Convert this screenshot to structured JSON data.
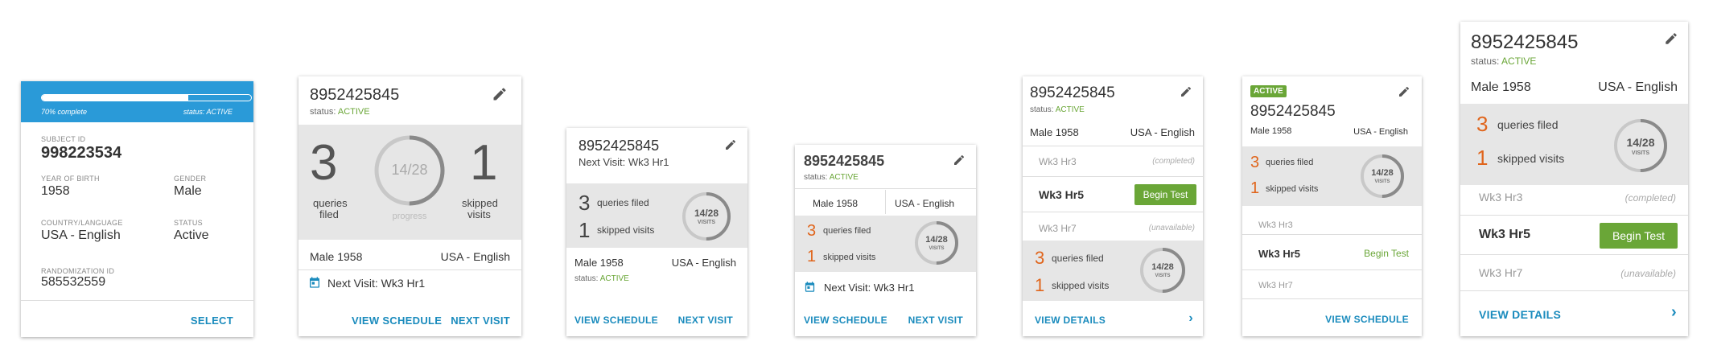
{
  "subject_id_val": "8952425845",
  "status_prefix": "status:",
  "status_value": "ACTIVE",
  "card1": {
    "progress_label": "70% complete",
    "progress_fraction": 0.7,
    "status_label": "status: ACTIVE",
    "subject_id_label": "SUBJECT ID",
    "subject_id": "998223534",
    "yob_label": "YEAR OF BIRTH",
    "yob": "1958",
    "gender_label": "GENDER",
    "gender": "Male",
    "country_label": "COUNTRY/LANGUAGE",
    "country": "USA - English",
    "status_field_label": "STATUS",
    "status_field": "Active",
    "rand_label": "RANDOMIZATION ID",
    "rand": "585532559",
    "select": "SELECT"
  },
  "card2": {
    "queries": "3",
    "queries_label1": "queries",
    "queries_label2": "filed",
    "ring_text": "14/28",
    "ring_fraction": 0.5,
    "progress_label": "progress",
    "skipped": "1",
    "skipped_label1": "skipped",
    "skipped_label2": "visits",
    "gender_yob": "Male  1958",
    "country": "USA - English",
    "next_visit": "Next Visit: Wk3 Hr1",
    "view_schedule": "VIEW SCHEDULE",
    "next_visit_btn": "NEXT VISIT"
  },
  "card3": {
    "next_visit": "Next Visit: Wk3 Hr1",
    "queries": "3",
    "queries_label": "queries filed",
    "skipped": "1",
    "skipped_label": "skipped visits",
    "ring_text": "14/28",
    "ring_sub": "VISITS",
    "gender_yob": "Male  1958",
    "country": "USA - English",
    "view_schedule": "VIEW SCHEDULE",
    "next_visit_btn": "NEXT VISIT"
  },
  "card4": {
    "gender_yob": "Male  1958",
    "country": "USA - English",
    "queries": "3",
    "queries_label": "queries filed",
    "skipped": "1",
    "skipped_label": "skipped visits",
    "ring_text": "14/28",
    "ring_sub": "VISITS",
    "next_visit": "Next Visit: Wk3 Hr1",
    "view_schedule": "VIEW SCHEDULE",
    "next_visit_btn": "NEXT VISIT"
  },
  "card5": {
    "gender_yob": "Male  1958",
    "country": "USA - English",
    "visits": [
      {
        "name": "Wk3 Hr3",
        "state": "(completed)"
      },
      {
        "name": "Wk3 Hr5",
        "action": "Begin Test"
      },
      {
        "name": "Wk3 Hr7",
        "state": "(unavailable)"
      }
    ],
    "queries": "3",
    "queries_label": "queries filed",
    "skipped": "1",
    "skipped_label": "skipped visits",
    "ring_text": "14/28",
    "ring_sub": "VISITS",
    "view_details": "VIEW DETAILS"
  },
  "card6": {
    "badge": "ACTIVE",
    "gender_yob": "Male  1958",
    "country": "USA - English",
    "queries": "3",
    "queries_label": "queries filed",
    "skipped": "1",
    "skipped_label": "skipped visits",
    "ring_text": "14/28",
    "ring_sub": "VISITS",
    "visits": [
      {
        "name": "Wk3 Hr3"
      },
      {
        "name": "Wk3 Hr5",
        "action": "Begin Test"
      },
      {
        "name": "Wk3 Hr7"
      }
    ],
    "view_schedule": "VIEW SCHEDULE"
  },
  "card7": {
    "gender_yob": "Male  1958",
    "country": "USA - English",
    "queries": "3",
    "queries_label": "queries filed",
    "skipped": "1",
    "skipped_label": "skipped visits",
    "ring_text": "14/28",
    "ring_sub": "VISITS",
    "visits": [
      {
        "name": "Wk3 Hr3",
        "state": "(completed)"
      },
      {
        "name": "Wk3 Hr5",
        "action": "Begin Test"
      },
      {
        "name": "Wk3 Hr7",
        "state": "(unavailable)"
      }
    ],
    "view_details": "VIEW DETAILS"
  },
  "colors": {
    "accent": "#1a8bbd",
    "green": "#6aa637",
    "orange": "#e0651c",
    "header_blue": "#2a9ad8"
  }
}
